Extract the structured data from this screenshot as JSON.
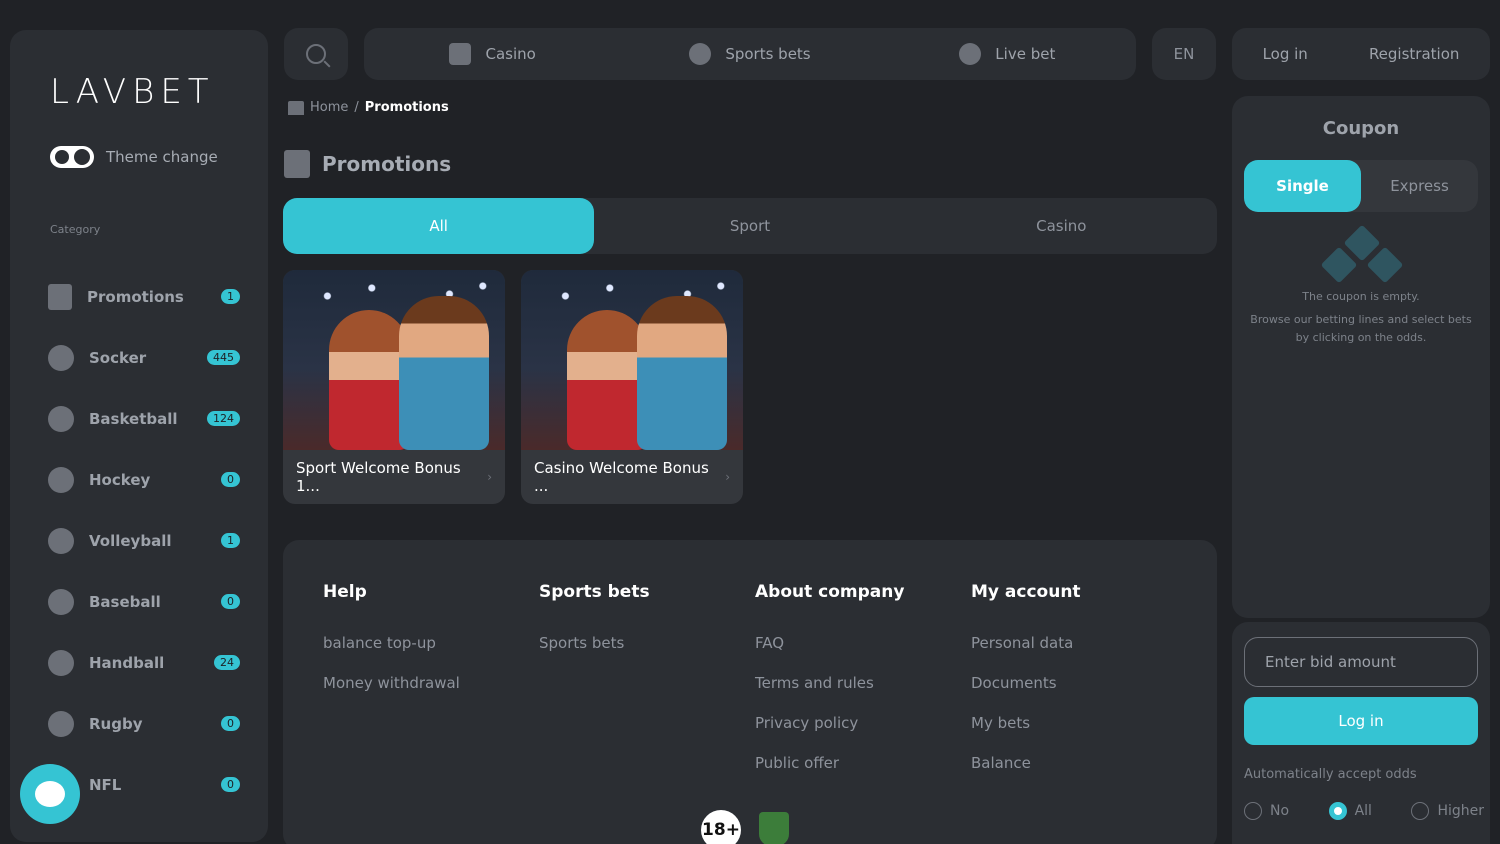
{
  "logo": {
    "text": "LAVBET"
  },
  "sidebar": {
    "theme_label": "Theme change",
    "category_label": "Category",
    "items": [
      {
        "label": "Promotions",
        "count": "1",
        "icon": "gift-icon"
      },
      {
        "label": "Socker",
        "count": "445",
        "icon": "soccer-ball-icon"
      },
      {
        "label": "Basketball",
        "count": "124",
        "icon": "basketball-icon"
      },
      {
        "label": "Hockey",
        "count": "0",
        "icon": "hockey-puck-icon"
      },
      {
        "label": "Volleyball",
        "count": "1",
        "icon": "volleyball-icon"
      },
      {
        "label": "Baseball",
        "count": "0",
        "icon": "baseball-icon"
      },
      {
        "label": "Handball",
        "count": "24",
        "icon": "handball-icon"
      },
      {
        "label": "Rugby",
        "count": "0",
        "icon": "rugby-ball-icon"
      },
      {
        "label": "NFL",
        "count": "0",
        "icon": "football-icon"
      }
    ]
  },
  "header": {
    "nav": [
      {
        "label": "Casino",
        "icon": "slot-machine-icon"
      },
      {
        "label": "Sports bets",
        "icon": "soccer-ball-icon"
      },
      {
        "label": "Live bet",
        "icon": "flame-icon"
      }
    ],
    "language": "EN",
    "login": "Log in",
    "register": "Registration"
  },
  "breadcrumb": {
    "home": "Home",
    "separator": "/",
    "current": "Promotions"
  },
  "page_title": "Promotions",
  "filter_tabs": [
    {
      "label": "All",
      "active": true
    },
    {
      "label": "Sport",
      "active": false
    },
    {
      "label": "Casino",
      "active": false
    }
  ],
  "promos": [
    {
      "title": "Sport Welcome Bonus 1..."
    },
    {
      "title": "Casino Welcome Bonus ..."
    }
  ],
  "footer": {
    "columns": [
      {
        "title": "Help",
        "links": [
          "balance top-up",
          "Money withdrawal"
        ]
      },
      {
        "title": "Sports bets",
        "links": [
          "Sports bets"
        ]
      },
      {
        "title": "About company",
        "links": [
          "FAQ",
          "Terms and rules",
          "Privacy policy",
          "Public offer"
        ]
      },
      {
        "title": "My account",
        "links": [
          "Personal data",
          "Documents",
          "My bets",
          "Balance"
        ]
      }
    ],
    "age_badge": "18+"
  },
  "coupon": {
    "title": "Coupon",
    "tabs": [
      {
        "label": "Single",
        "active": true
      },
      {
        "label": "Express",
        "active": false
      }
    ],
    "empty_title": "The coupon is empty.",
    "empty_text": "Browse our betting lines and select bets by clicking on the odds.",
    "bid_placeholder": "Enter bid amount",
    "login_button": "Log in",
    "auto_accept_label": "Automatically accept odds",
    "odds_options": [
      {
        "label": "No",
        "selected": false
      },
      {
        "label": "All",
        "selected": true
      },
      {
        "label": "Higher",
        "selected": false
      }
    ]
  },
  "colors": {
    "accent": "#35c4d3",
    "background": "#202226",
    "panel": "#2b2e33"
  }
}
